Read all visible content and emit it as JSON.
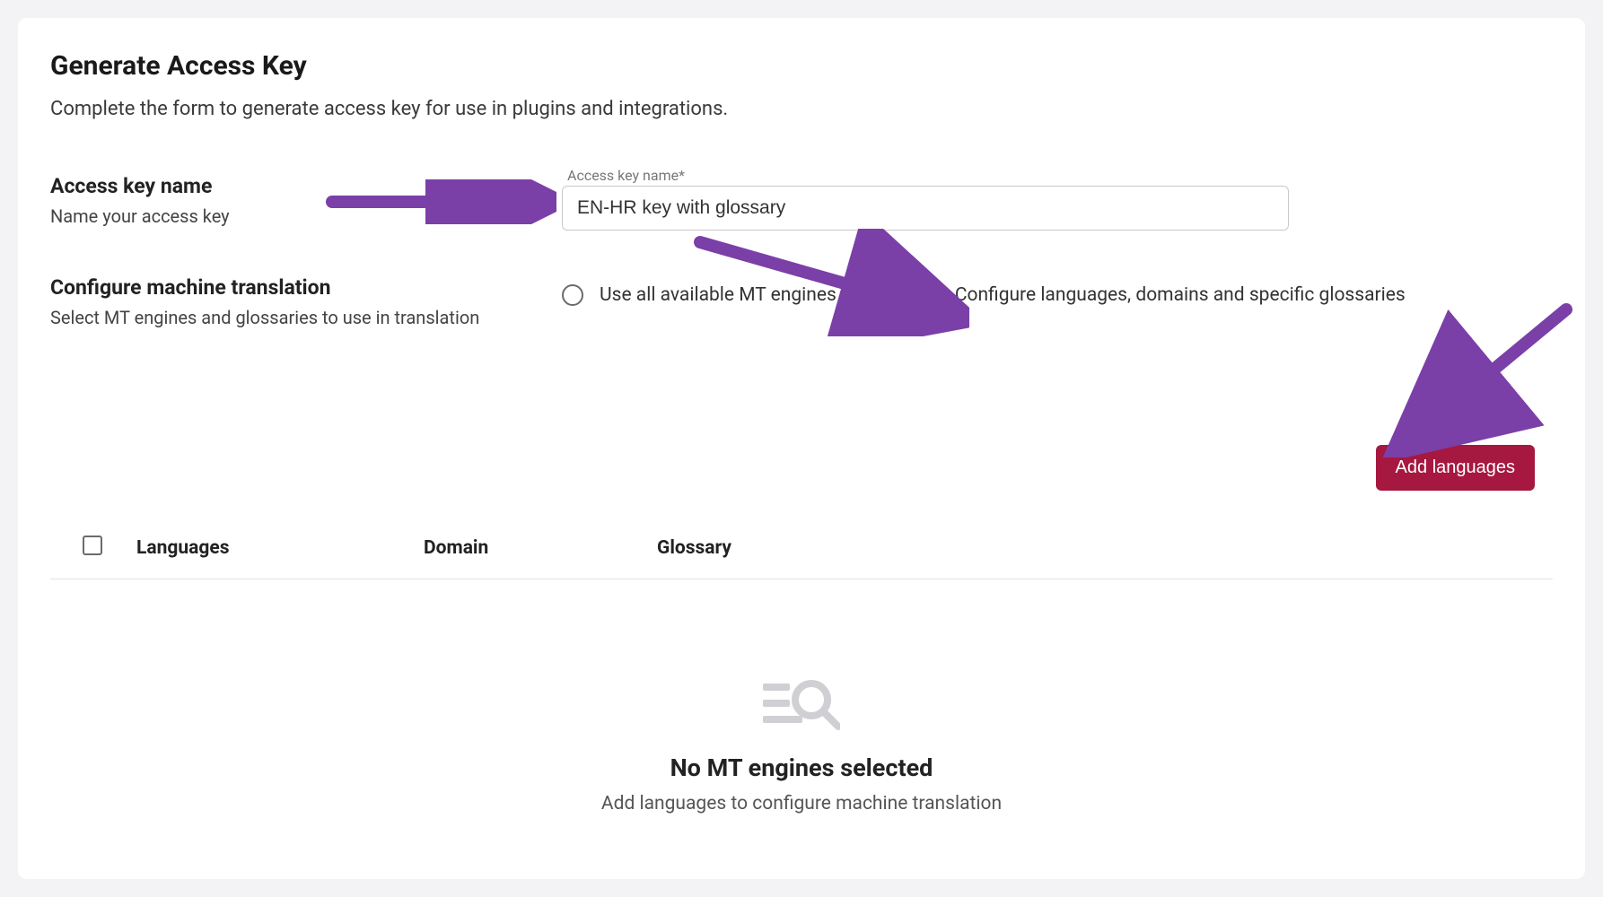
{
  "page": {
    "title": "Generate Access Key",
    "subtitle": "Complete the form to generate access key for use in plugins and integrations."
  },
  "accessKey": {
    "section_label": "Access key name",
    "section_help": "Name your access key",
    "float_label": "Access key name*",
    "value": "EN-HR key with glossary"
  },
  "configureMT": {
    "section_label": "Configure machine translation",
    "section_help": "Select MT engines and glossaries to use in translation",
    "option_all": "Use all available MT engines",
    "option_specific": "Configure languages, domains and specific glossaries",
    "selected": "specific"
  },
  "actions": {
    "add_languages": "Add languages"
  },
  "table": {
    "col_languages": "Languages",
    "col_domain": "Domain",
    "col_glossary": "Glossary"
  },
  "empty": {
    "title": "No MT engines selected",
    "subtitle": "Add languages to configure machine translation"
  },
  "annotation_color": "#7b3fa8"
}
